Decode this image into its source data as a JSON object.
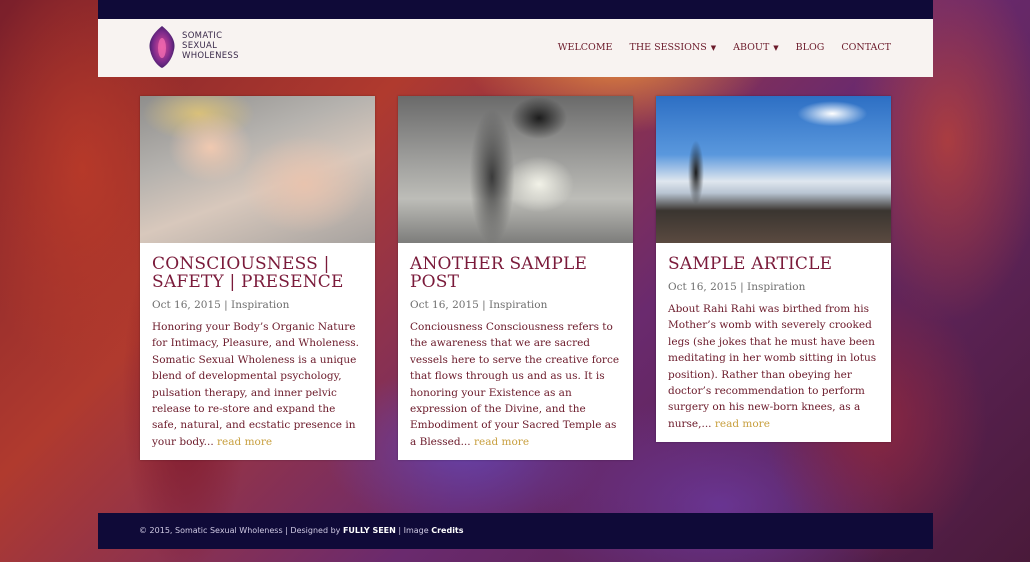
{
  "brand": {
    "line1": "SOMATIC",
    "line2": "SEXUAL",
    "line3": "WHOLENESS"
  },
  "nav": {
    "welcome": "WELCOME",
    "sessions": "THE SESSIONS",
    "about": "ABOUT",
    "blog": "BLOG",
    "contact": "CONTACT"
  },
  "posts": [
    {
      "title": "CONSCIOUSNESS | SAFETY | PRESENCE",
      "date": "Oct 16, 2015",
      "sep": "|",
      "category": "Inspiration",
      "excerpt": "Honoring your Body’s Organic Nature for Intimacy, Pleasure, and Wholeness. Somatic Sexual Wholeness is a unique blend of developmental psychology, pulsation therapy, and inner pelvic release to re-store and expand the safe, natural, and ecstatic presence in your body...",
      "read_more": "read more"
    },
    {
      "title": "ANOTHER SAMPLE POST",
      "date": "Oct 16, 2015",
      "sep": "|",
      "category": "Inspiration",
      "excerpt": "Conciousness Consciousness refers to the awareness that we are sacred vessels here to serve the creative force that flows through us and as us. It is honoring your Existence as an expression of the Divine, and the Embodiment of your Sacred Temple as a Blessed...",
      "read_more": "read more"
    },
    {
      "title": "SAMPLE ARTICLE",
      "date": "Oct 16, 2015",
      "sep": "|",
      "category": "Inspiration",
      "excerpt": "About Rahi Rahi was birthed from his Mother’s womb with severely crooked legs (she jokes that he must have been meditating in her womb sitting in lotus position).  Rather than obeying her doctor’s recommendation to perform surgery on his new-born knees, as a nurse,...",
      "read_more": "read more"
    }
  ],
  "footer": {
    "prefix": "© 2015, Somatic Sexual Wholeness | Designed by",
    "designer": "FULLY SEEN",
    "mid": "| Image",
    "credits": "Credits"
  }
}
